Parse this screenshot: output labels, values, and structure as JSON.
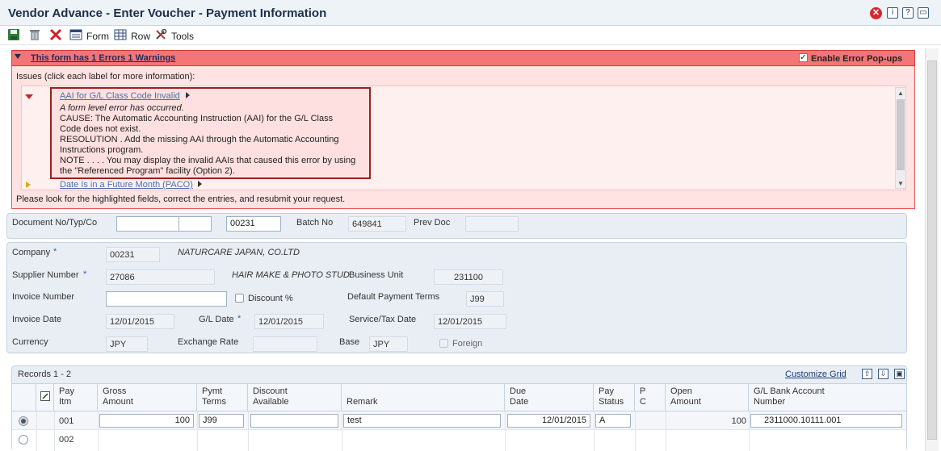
{
  "window": {
    "title": "Vendor Advance - Enter Voucher - Payment Information"
  },
  "toolbar": {
    "form_label": "Form",
    "row_label": "Row",
    "tools_label": "Tools"
  },
  "error_panel": {
    "title": "This form has 1 Errors 1 Warnings",
    "enable_popups_label": "Enable Error Pop-ups",
    "issues_label": "Issues (click each label for more information):",
    "issues": [
      {
        "label": "AAI for G/L Class Code Invalid",
        "lines": [
          "A form level error has occurred.",
          "CAUSE: The Automatic Accounting Instruction (AAI) for the G/L Class",
          "Code does not exist.",
          "RESOLUTION . Add the missing AAI through the Automatic Accounting",
          "Instructions program.",
          "NOTE . . . . You may display the invalid AAIs that caused this error by using",
          "the \"Referenced Program\" facility (Option 2)."
        ]
      },
      {
        "label": "Date Is in a Future Month (PACO)"
      }
    ],
    "footer": "Please look for the highlighted fields, correct the entries, and resubmit your request."
  },
  "header": {
    "document_label": "Document No/Typ/Co",
    "document_no": "",
    "document_type": "",
    "document_co": "00231",
    "batch_label": "Batch No",
    "batch_no": "649841",
    "prev_doc_label": "Prev Doc",
    "prev_doc": ""
  },
  "details": {
    "company_label": "Company",
    "company": "00231",
    "company_name": "NATURCARE JAPAN, CO.LTD",
    "supplier_label": "Supplier Number",
    "supplier": "27086",
    "supplier_name": "HAIR MAKE & PHOTO STUD.",
    "business_unit_label": "Business Unit",
    "business_unit": "231100",
    "invoice_number_label": "Invoice Number",
    "invoice_number": "",
    "discount_label": "Discount %",
    "default_terms_label": "Default Payment Terms",
    "default_terms": "J99",
    "invoice_date_label": "Invoice Date",
    "invoice_date": "12/01/2015",
    "gl_date_label": "G/L Date",
    "gl_date": "12/01/2015",
    "service_date_label": "Service/Tax Date",
    "service_date": "12/01/2015",
    "currency_label": "Currency",
    "currency": "JPY",
    "exchange_rate_label": "Exchange Rate",
    "exchange_rate": "",
    "base_label": "Base",
    "base": "JPY",
    "foreign_label": "Foreign"
  },
  "grid": {
    "records_label": "Records 1 - 2",
    "customize_label": "Customize Grid",
    "columns": [
      {
        "l1": "Pay",
        "l2": "Itm"
      },
      {
        "l1": "Gross",
        "l2": "Amount"
      },
      {
        "l1": "Pymt",
        "l2": "Terms"
      },
      {
        "l1": "Discount",
        "l2": "Available"
      },
      {
        "l1": "",
        "l2": "Remark"
      },
      {
        "l1": "Due",
        "l2": "Date"
      },
      {
        "l1": "Pay",
        "l2": "Status"
      },
      {
        "l1": "P",
        "l2": "C"
      },
      {
        "l1": "Open",
        "l2": "Amount"
      },
      {
        "l1": "G/L Bank Account",
        "l2": "Number"
      }
    ],
    "rows": [
      {
        "pay_itm": "001",
        "gross": "100",
        "terms": "J99",
        "discount": "",
        "remark": "test",
        "due_date": "12/01/2015",
        "status": "A",
        "pc": "",
        "open": "100",
        "gl_bank": "2311000.10111.001"
      },
      {
        "pay_itm": "002"
      }
    ]
  },
  "colors": {
    "error_header": "#f47575",
    "error_body": "#ffe3e3",
    "panel": "#e9eef5",
    "title": "#1d2f4a"
  }
}
